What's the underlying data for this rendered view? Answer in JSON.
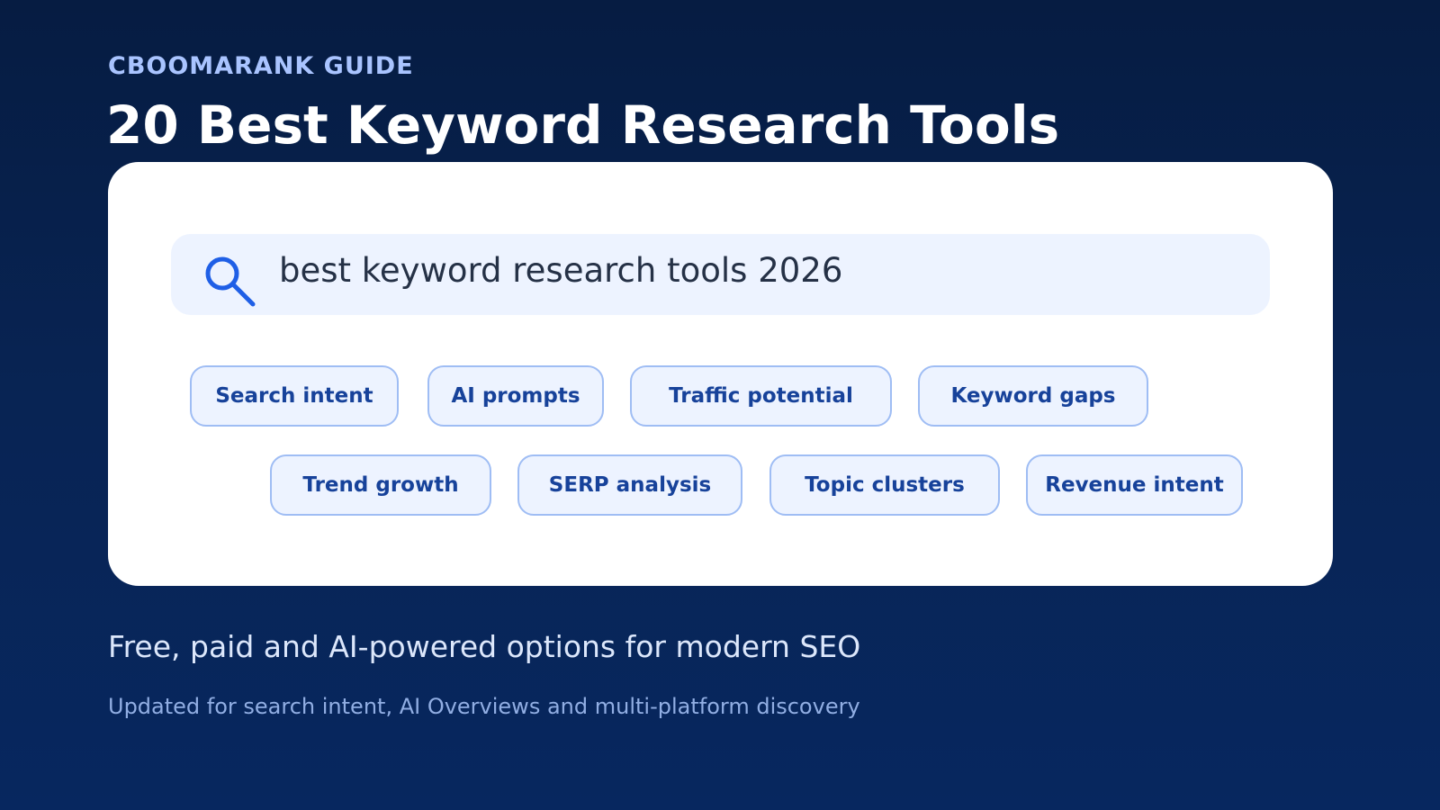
{
  "header": {
    "eyebrow": "CBOOMARANK GUIDE",
    "title": "20 Best Keyword Research Tools"
  },
  "search": {
    "query": "best keyword research tools 2026",
    "icon": "search-icon"
  },
  "chips": [
    "Search intent",
    "AI prompts",
    "Traffic potential",
    "Keyword gaps",
    "Trend growth",
    "SERP analysis",
    "Topic clusters",
    "Revenue intent"
  ],
  "footer": {
    "tagline": "Free, paid and AI-powered options for modern SEO",
    "subline": "Updated for search intent, AI Overviews and multi-platform discovery"
  },
  "colors": {
    "background": "#072356",
    "accent": "#1f5fe6",
    "chip_text": "#17429a",
    "chip_bg": "#edf3ff"
  }
}
